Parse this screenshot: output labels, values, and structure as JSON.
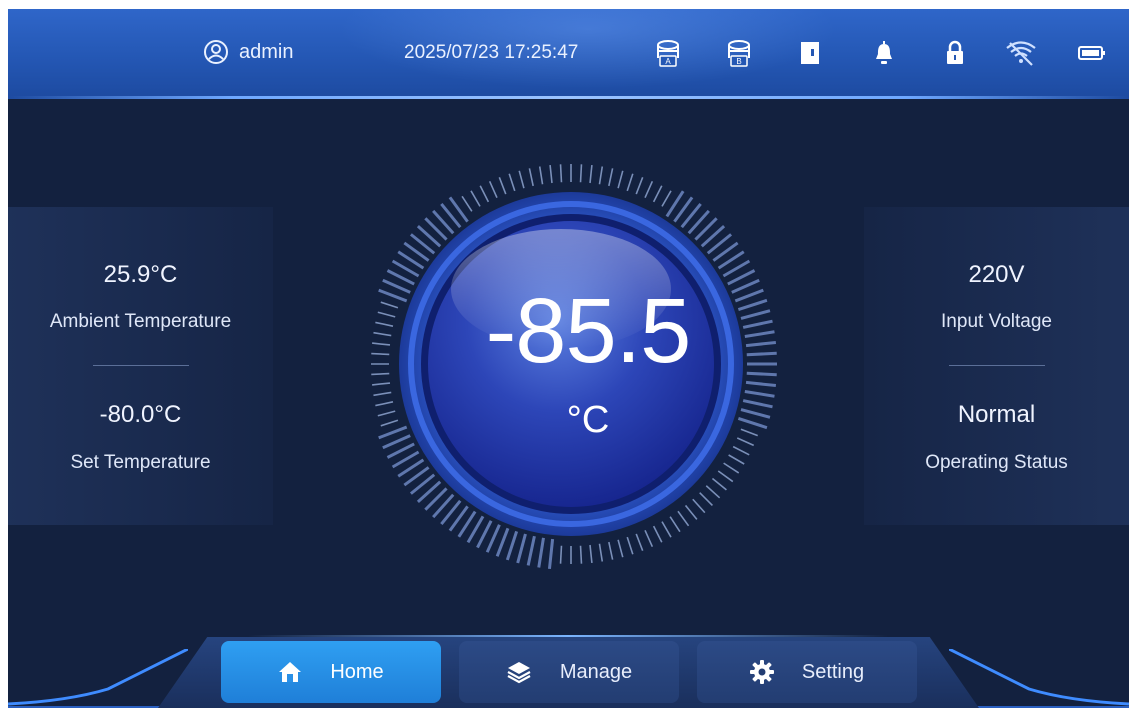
{
  "header": {
    "user": "admin",
    "datetime": "2025/07/23 17:25:47",
    "status_icons": [
      "compressor-a-icon",
      "compressor-b-icon",
      "door-icon",
      "bell-icon",
      "lock-icon",
      "wifi-icon",
      "battery-icon"
    ],
    "compressor_a_letter": "A",
    "compressor_b_letter": "B"
  },
  "left_panel": {
    "ambient_value": "25.9°C",
    "ambient_label": "Ambient Temperature",
    "set_value": "-80.0°C",
    "set_label": "Set Temperature"
  },
  "right_panel": {
    "voltage_value": "220V",
    "voltage_label": "Input Voltage",
    "status_value": "Normal",
    "status_label": "Operating Status"
  },
  "gauge": {
    "temperature": "-85.5",
    "unit": "°C"
  },
  "nav": {
    "tabs": [
      {
        "label": "Home",
        "icon": "home-icon",
        "active": true
      },
      {
        "label": "Manage",
        "icon": "layers-icon",
        "active": false
      },
      {
        "label": "Setting",
        "icon": "gear-icon",
        "active": false
      }
    ]
  },
  "colors": {
    "background": "#13213f",
    "header": "#2457b4",
    "accent": "#2f9ff2",
    "tab": "#233d72"
  }
}
